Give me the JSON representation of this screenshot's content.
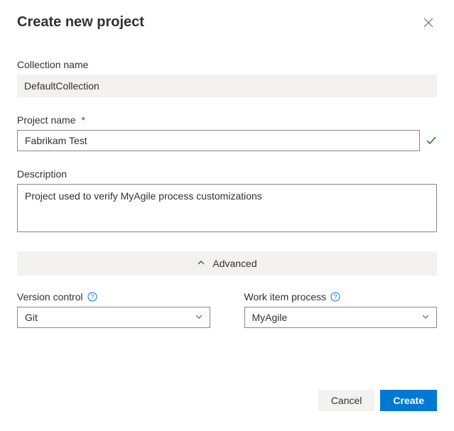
{
  "dialog": {
    "title": "Create new project"
  },
  "fields": {
    "collection": {
      "label": "Collection name",
      "value": "DefaultCollection"
    },
    "projectName": {
      "label": "Project name",
      "value": "Fabrikam Test"
    },
    "description": {
      "label": "Description",
      "value": "Project used to verify MyAgile process customizations"
    },
    "versionControl": {
      "label": "Version control",
      "value": "Git"
    },
    "workItemProcess": {
      "label": "Work item process",
      "value": "MyAgile"
    }
  },
  "advanced": {
    "label": "Advanced"
  },
  "footer": {
    "cancel": "Cancel",
    "create": "Create"
  }
}
